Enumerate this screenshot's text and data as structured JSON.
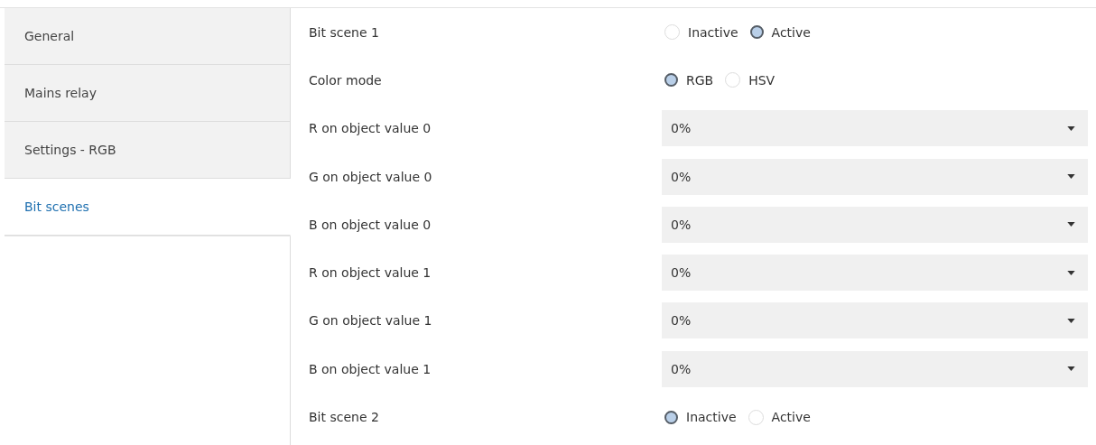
{
  "sidebar": {
    "items": [
      {
        "label": "General",
        "selected": false
      },
      {
        "label": "Mains relay",
        "selected": false
      },
      {
        "label": "Settings - RGB",
        "selected": false
      },
      {
        "label": "Bit scenes",
        "selected": true
      }
    ]
  },
  "parameters": [
    {
      "kind": "radio",
      "label": "Bit scene 1",
      "options": [
        {
          "label": "Inactive",
          "selected": false
        },
        {
          "label": "Active",
          "selected": true
        }
      ]
    },
    {
      "kind": "radio",
      "label": "Color mode",
      "options": [
        {
          "label": "RGB",
          "selected": true
        },
        {
          "label": "HSV",
          "selected": false
        }
      ]
    },
    {
      "kind": "dropdown",
      "label": "R on object value 0",
      "value": "0%"
    },
    {
      "kind": "dropdown",
      "label": "G on object value 0",
      "value": "0%"
    },
    {
      "kind": "dropdown",
      "label": "B on object value 0",
      "value": "0%"
    },
    {
      "kind": "dropdown",
      "label": "R on object value 1",
      "value": "0%"
    },
    {
      "kind": "dropdown",
      "label": "G on object value 1",
      "value": "0%"
    },
    {
      "kind": "dropdown",
      "label": "B on object value 1",
      "value": "0%"
    },
    {
      "kind": "radio",
      "label": "Bit scene 2",
      "options": [
        {
          "label": "Inactive",
          "selected": true
        },
        {
          "label": "Active",
          "selected": false
        }
      ]
    }
  ]
}
